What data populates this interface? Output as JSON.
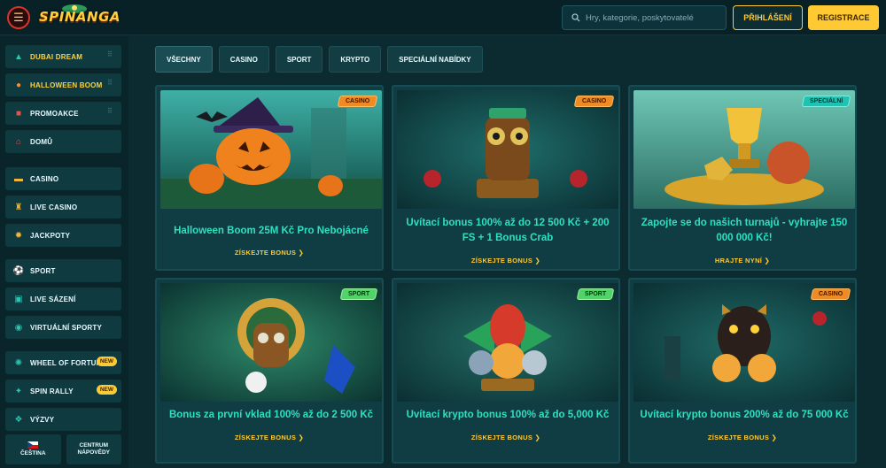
{
  "header": {
    "logo_text": "SPINANGA",
    "search_placeholder": "Hry, kategorie, poskytovatelé",
    "login_label": "PŘIHLÁŠENÍ",
    "register_label": "REGISTRACE"
  },
  "sidebar": {
    "promo": [
      {
        "label": "DUBAI DREAM",
        "icon": "tower-icon",
        "gold": true
      },
      {
        "label": "HALLOWEEN BOOM",
        "icon": "pumpkin-icon",
        "gold": true
      },
      {
        "label": "PROMOAKCE",
        "icon": "gift-icon",
        "gold": false
      },
      {
        "label": "DOMŮ",
        "icon": "home-icon",
        "gold": false
      }
    ],
    "casino": [
      {
        "label": "CASINO",
        "icon": "treasure-chest-icon"
      },
      {
        "label": "LIVE CASINO",
        "icon": "live-dealer-icon"
      },
      {
        "label": "JACKPOTY",
        "icon": "jackpot-icon"
      }
    ],
    "sport": [
      {
        "label": "SPORT",
        "icon": "football-icon"
      },
      {
        "label": "LIVE SÁZENÍ",
        "icon": "live-betting-icon"
      },
      {
        "label": "VIRTUÁLNÍ SPORTY",
        "icon": "virtual-sports-icon"
      }
    ],
    "extras": [
      {
        "label": "WHEEL OF FORTUNE",
        "icon": "wheel-icon",
        "badge": "NEW"
      },
      {
        "label": "SPIN RALLY",
        "icon": "rally-icon",
        "badge": "NEW"
      },
      {
        "label": "VÝZVY",
        "icon": "challenge-icon"
      }
    ],
    "bottom": {
      "language_label": "ČEŠTINA",
      "help_label_1": "CENTRUM",
      "help_label_2": "NÁPOVĚDY"
    }
  },
  "tabs": [
    "VŠECHNY",
    "CASINO",
    "SPORT",
    "KRYPTO",
    "SPECIÁLNÍ NABÍDKY"
  ],
  "promos": [
    {
      "tag": "CASINO",
      "title": "Halloween Boom 25M Kč Pro Nebojácné",
      "cta": "ZÍSKEJTE BONUS ❯"
    },
    {
      "tag": "CASINO",
      "title": "Uvítací bonus 100% až do 12 500 Kč + 200 FS + 1 Bonus Crab",
      "cta": "ZÍSKEJTE BONUS ❯"
    },
    {
      "tag": "SPECIÁLNÍ",
      "title": "Zapojte se do našich turnajů - vyhrajte 150 000 000 Kč!",
      "cta": "HRAJTE NYNÍ ❯"
    },
    {
      "tag": "SPORT",
      "title": "Bonus za první vklad 100% až do 2 500 Kč",
      "cta": "ZÍSKEJTE BONUS ❯"
    },
    {
      "tag": "SPORT",
      "title": "Uvítací krypto bonus 100% až do 5,000 Kč",
      "cta": "ZÍSKEJTE BONUS ❯"
    },
    {
      "tag": "CASINO",
      "title": "Uvítací krypto bonus 200% až do 75 000 Kč",
      "cta": "ZÍSKEJTE BONUS ❯"
    }
  ],
  "colors": {
    "accent_gold": "#ffc933",
    "title_teal": "#2ee0c0",
    "background": "#0c2b31"
  }
}
